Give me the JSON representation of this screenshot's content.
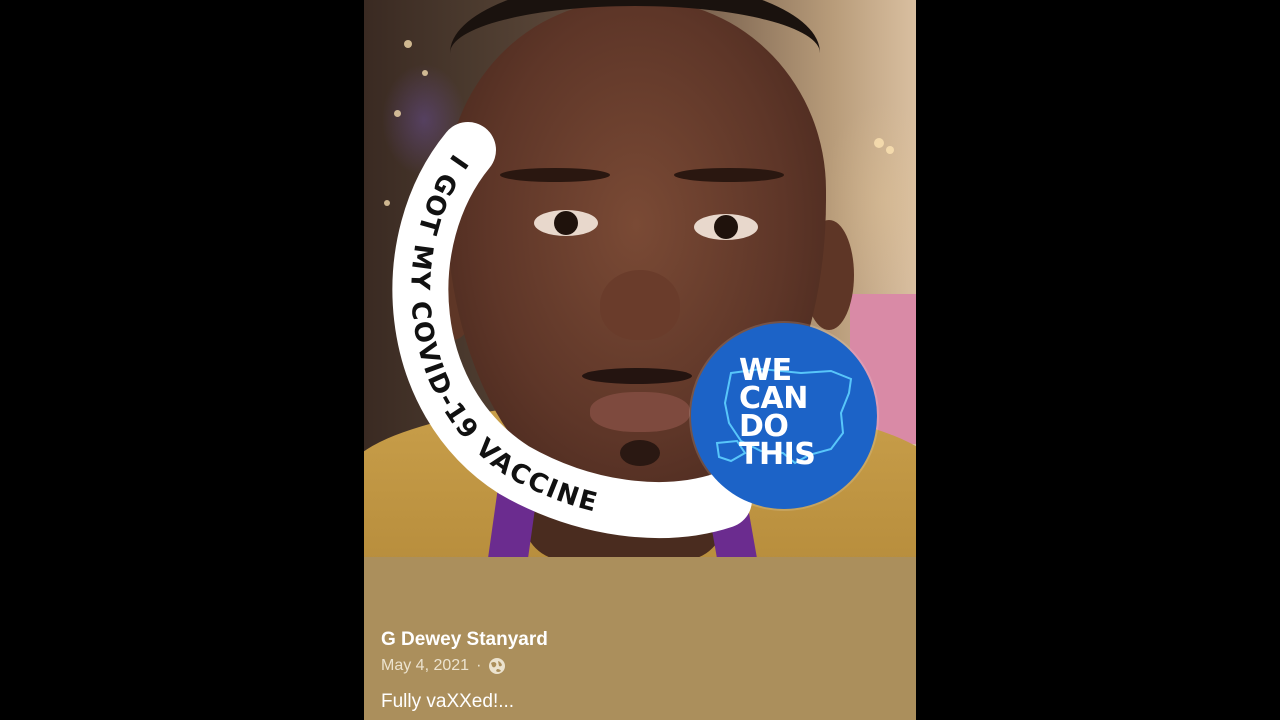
{
  "post": {
    "author": "G Dewey Stanyard",
    "date": "May 4, 2021",
    "separator": "·",
    "privacy_icon": "globe-icon",
    "text": "Fully vaXXed!..."
  },
  "photo_frame": {
    "ring_text": "I GOT MY COVID-19 VACCINE",
    "badge_lines": [
      "WE",
      "CAN",
      "DO",
      "THIS"
    ],
    "badge_color": "#1c63c7",
    "ring_color": "#ffffff"
  },
  "colors": {
    "caption_background": "#ab8f5c",
    "letterbox": "#000000"
  }
}
